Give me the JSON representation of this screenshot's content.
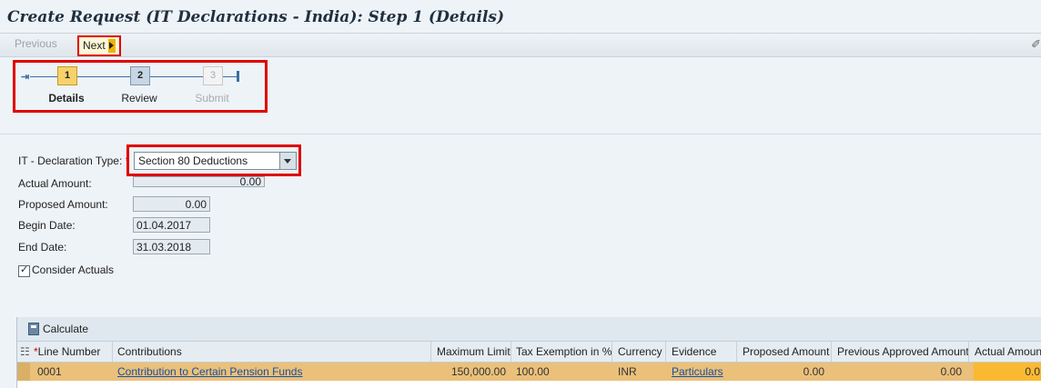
{
  "title": "Create Request (IT Declarations - India): Step 1  (Details)",
  "toolbar": {
    "previous": "Previous",
    "next": "Next"
  },
  "roadmap": {
    "steps": [
      {
        "num": "1",
        "label": "Details"
      },
      {
        "num": "2",
        "label": "Review"
      },
      {
        "num": "3",
        "label": "Submit"
      }
    ]
  },
  "form": {
    "declaration_type_label": "IT - Declaration Type:",
    "declaration_type_value": "Section 80 Deductions",
    "actual_amount_label": "Actual Amount:",
    "actual_amount_value": "0.00",
    "proposed_amount_label": "Proposed Amount:",
    "proposed_amount_value": "0.00",
    "begin_date_label": "Begin Date:",
    "begin_date_value": "01.04.2017",
    "end_date_label": "End Date:",
    "end_date_value": "31.03.2018",
    "consider_actuals_label": "Consider Actuals",
    "required_marker": "*"
  },
  "table": {
    "calculate_label": "Calculate",
    "columns": [
      "Line Number",
      "Contributions",
      "Maximum Limit",
      "Tax Exemption in %",
      "Currency",
      "Evidence",
      "Proposed Amount",
      "Previous Approved Amount",
      "Actual Amount"
    ],
    "rows": [
      {
        "line": "0001",
        "contribution": "Contribution to Certain Pension Funds",
        "max_limit": "150,000.00",
        "tax_exemption": "100.00",
        "currency": "INR",
        "evidence": "Particulars",
        "proposed": "0.00",
        "previous_approved": "0.00",
        "actual": "0.0"
      }
    ]
  }
}
